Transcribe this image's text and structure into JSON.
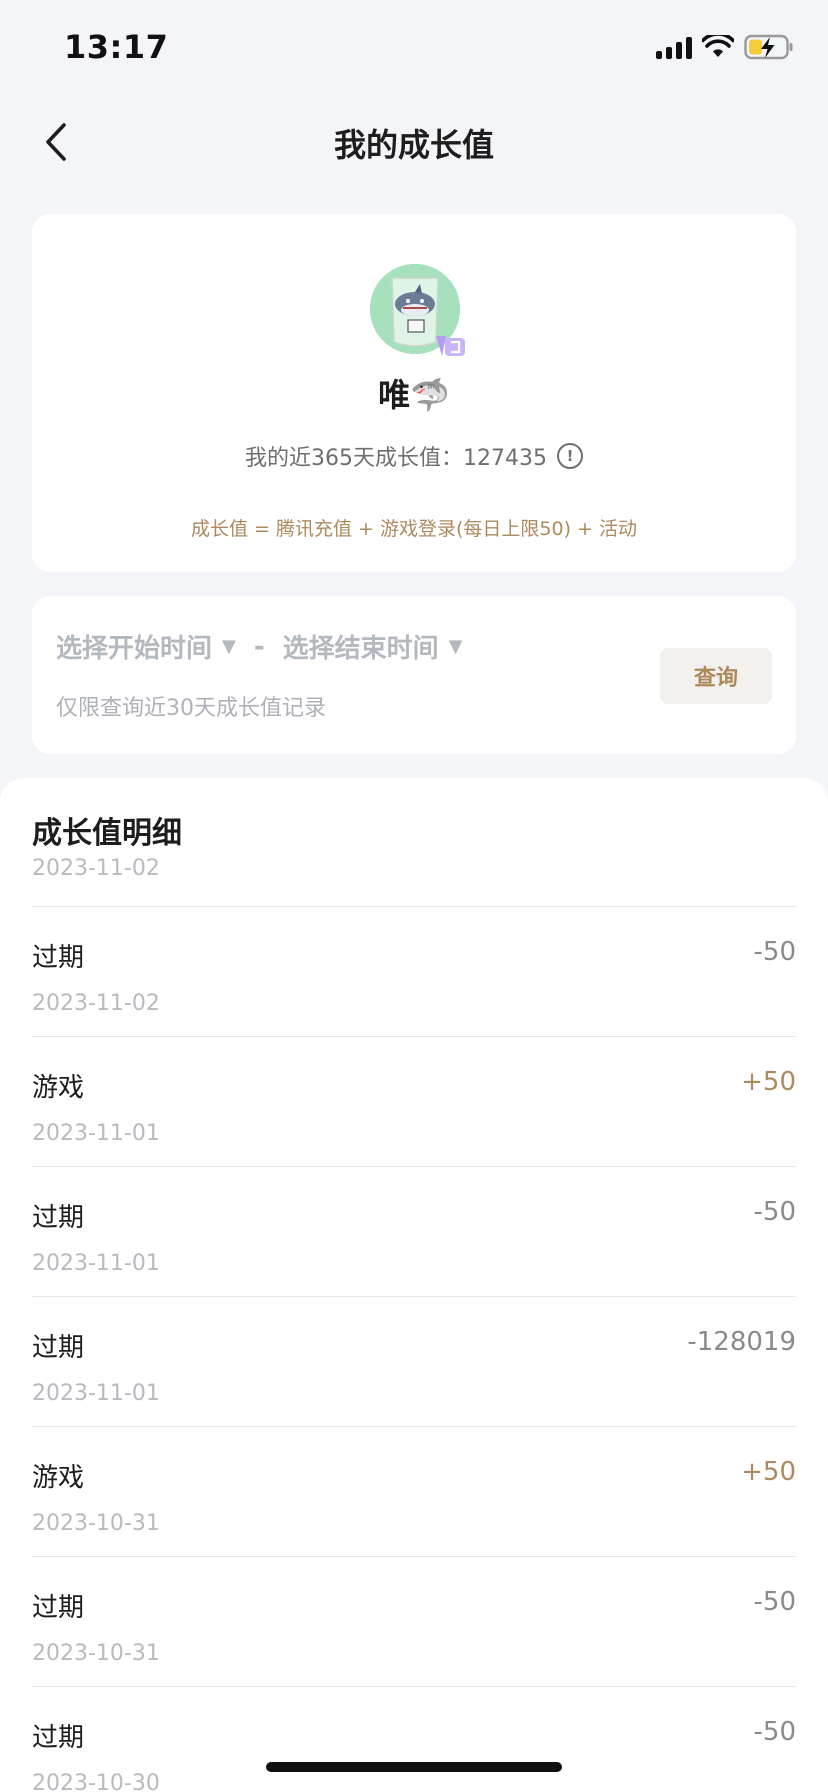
{
  "status_bar": {
    "time": "13:17",
    "icons": [
      "signal-icon",
      "wifi-icon",
      "battery-charging-icon"
    ]
  },
  "nav": {
    "title": "我的成长值",
    "back_icon": "chevron-left-icon"
  },
  "profile": {
    "avatar_icon": "shark-avatar",
    "name": "唯🦈",
    "growth_label": "我的近365天成长值：127435",
    "info_icon": "info-icon",
    "formula": "成长值 = 腾讯充值 + 游戏登录(每日上限50) + 活动"
  },
  "filter": {
    "start_placeholder": "选择开始时间",
    "separator": "-",
    "end_placeholder": "选择结束时间",
    "caret": "▼",
    "hint": "仅限查询近30天成长值记录",
    "query_label": "查询"
  },
  "detail": {
    "title": "成长值明细",
    "date": "2023-11-02",
    "records": [
      {
        "type": "过期",
        "date": "2023-11-02",
        "amount": "-50",
        "positive": false
      },
      {
        "type": "游戏",
        "date": "2023-11-01",
        "amount": "+50",
        "positive": true
      },
      {
        "type": "过期",
        "date": "2023-11-01",
        "amount": "-50",
        "positive": false
      },
      {
        "type": "过期",
        "date": "2023-11-01",
        "amount": "-128019",
        "positive": false
      },
      {
        "type": "游戏",
        "date": "2023-10-31",
        "amount": "+50",
        "positive": true
      },
      {
        "type": "过期",
        "date": "2023-10-31",
        "amount": "-50",
        "positive": false
      },
      {
        "type": "过期",
        "date": "2023-10-30",
        "amount": "-50",
        "positive": false
      }
    ]
  },
  "colors": {
    "accent_gold": "#ad8a5e",
    "muted_text": "#b7babf",
    "background": "#f4f5f8"
  }
}
